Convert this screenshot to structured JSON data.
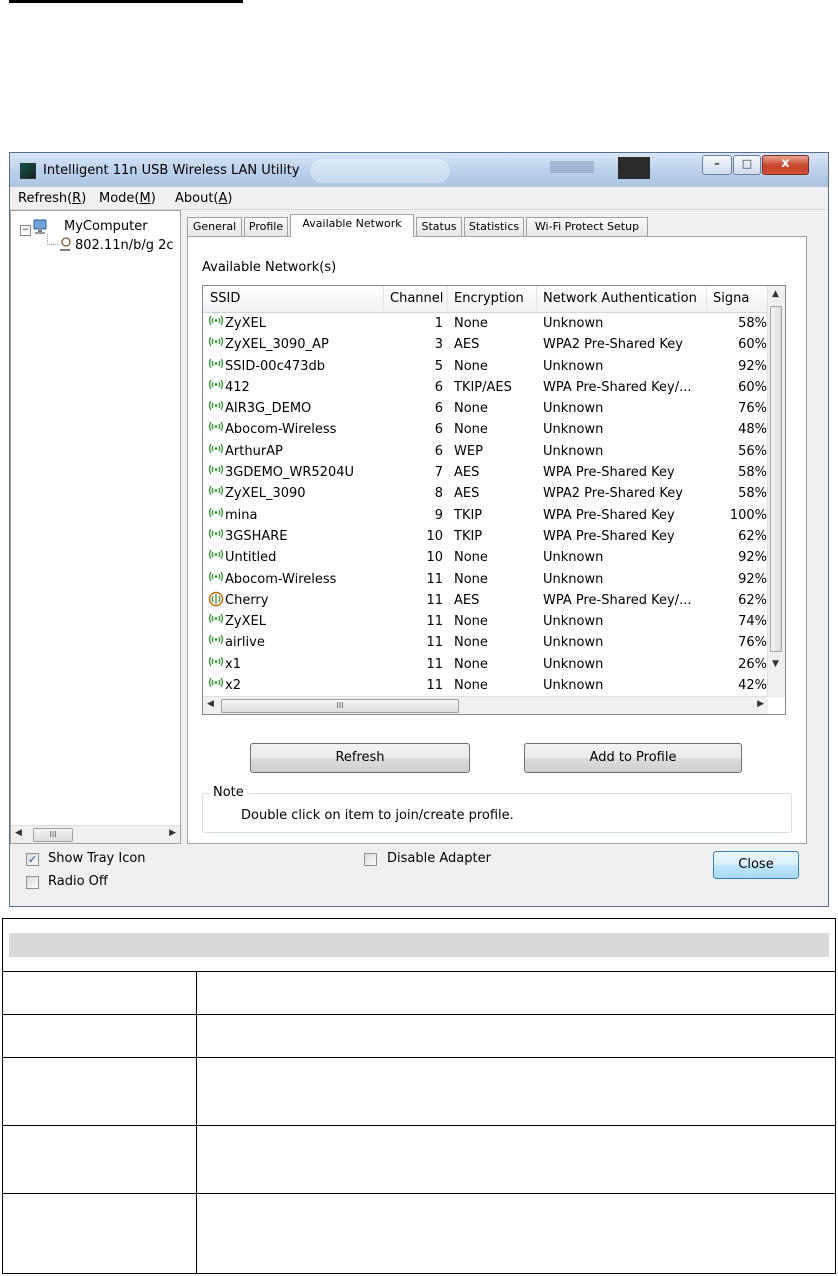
{
  "window": {
    "title": "Intelligent 11n USB Wireless LAN Utility",
    "controls": {
      "minimize": "–",
      "maximize": "□",
      "close": "x"
    }
  },
  "menu": [
    {
      "prefix": "Refresh(",
      "key": "R",
      "suffix": ")"
    },
    {
      "prefix": "Mode(",
      "key": "M",
      "suffix": ")"
    },
    {
      "prefix": "About(",
      "key": "A",
      "suffix": ")"
    }
  ],
  "tree": {
    "root": "MyComputer",
    "expander": "−",
    "child": "802.11n/b/g 2c",
    "scroll_thumb": "III"
  },
  "tabs": [
    "General",
    "Profile",
    "Available Network",
    "Status",
    "Statistics",
    "Wi-Fi Protect Setup"
  ],
  "active_tab": "Available Network",
  "panel": {
    "section_label": "Available Network(s)",
    "columns": [
      "SSID",
      "Channel",
      "Encryption",
      "Network Authentication",
      "Signa"
    ],
    "networks": [
      {
        "ssid": "ZyXEL",
        "channel": "1",
        "encryption": "None",
        "auth": "Unknown",
        "signal": "58%",
        "icon": "wifi-signal-icon"
      },
      {
        "ssid": "ZyXEL_3090_AP",
        "channel": "3",
        "encryption": "AES",
        "auth": "WPA2 Pre-Shared Key",
        "signal": "60%",
        "icon": "wifi-signal-icon"
      },
      {
        "ssid": "SSID-00c473db",
        "channel": "5",
        "encryption": "None",
        "auth": "Unknown",
        "signal": "92%",
        "icon": "wifi-signal-icon"
      },
      {
        "ssid": "412",
        "channel": "6",
        "encryption": "TKIP/AES",
        "auth": "WPA Pre-Shared Key/...",
        "signal": "60%",
        "icon": "wifi-signal-icon"
      },
      {
        "ssid": "AIR3G_DEMO",
        "channel": "6",
        "encryption": "None",
        "auth": "Unknown",
        "signal": "76%",
        "icon": "wifi-signal-icon"
      },
      {
        "ssid": "Abocom-Wireless",
        "channel": "6",
        "encryption": "None",
        "auth": "Unknown",
        "signal": "48%",
        "icon": "wifi-signal-icon"
      },
      {
        "ssid": "ArthurAP",
        "channel": "6",
        "encryption": "WEP",
        "auth": "Unknown",
        "signal": "56%",
        "icon": "wifi-signal-icon"
      },
      {
        "ssid": "3GDEMO_WR5204U",
        "channel": "7",
        "encryption": "AES",
        "auth": "WPA Pre-Shared Key",
        "signal": "58%",
        "icon": "wifi-signal-icon"
      },
      {
        "ssid": "ZyXEL_3090",
        "channel": "8",
        "encryption": "AES",
        "auth": "WPA2 Pre-Shared Key",
        "signal": "58%",
        "icon": "wifi-signal-icon"
      },
      {
        "ssid": "mina",
        "channel": "9",
        "encryption": "TKIP",
        "auth": "WPA Pre-Shared Key",
        "signal": "100%",
        "icon": "wifi-signal-icon"
      },
      {
        "ssid": "3GSHARE",
        "channel": "10",
        "encryption": "TKIP",
        "auth": "WPA Pre-Shared Key",
        "signal": "62%",
        "icon": "wifi-signal-icon"
      },
      {
        "ssid": "Untitled",
        "channel": "10",
        "encryption": "None",
        "auth": "Unknown",
        "signal": "92%",
        "icon": "wifi-signal-icon"
      },
      {
        "ssid": "Abocom-Wireless",
        "channel": "11",
        "encryption": "None",
        "auth": "Unknown",
        "signal": "92%",
        "icon": "wifi-signal-icon"
      },
      {
        "ssid": "Cherry",
        "channel": "11",
        "encryption": "AES",
        "auth": "WPA Pre-Shared Key/...",
        "signal": "62%",
        "icon": "wifi-connected-icon"
      },
      {
        "ssid": "ZyXEL",
        "channel": "11",
        "encryption": "None",
        "auth": "Unknown",
        "signal": "74%",
        "icon": "wifi-signal-icon"
      },
      {
        "ssid": "airlive",
        "channel": "11",
        "encryption": "None",
        "auth": "Unknown",
        "signal": "76%",
        "icon": "wifi-signal-icon"
      },
      {
        "ssid": "x1",
        "channel": "11",
        "encryption": "None",
        "auth": "Unknown",
        "signal": "26%",
        "icon": "wifi-signal-icon"
      },
      {
        "ssid": "x2",
        "channel": "11",
        "encryption": "None",
        "auth": "Unknown",
        "signal": "42%",
        "icon": "wifi-signal-icon"
      }
    ],
    "scroll_thumb": "III",
    "refresh_button": "Refresh",
    "add_profile_button": "Add to Profile",
    "note_title": "Note",
    "note_text": "Double click on item to join/create profile."
  },
  "bottom": {
    "show_tray_icon": {
      "label": "Show Tray Icon",
      "checked": true
    },
    "radio_off": {
      "label": "Radio Off",
      "checked": false
    },
    "disable_adapter": {
      "label": "Disable Adapter",
      "checked": false
    },
    "close_button": "Close"
  },
  "colors": {
    "signal_green": "#2e9a2e",
    "connected_ring": "#c06a00",
    "close_red": "#c7432a"
  },
  "checkmark": "✓"
}
